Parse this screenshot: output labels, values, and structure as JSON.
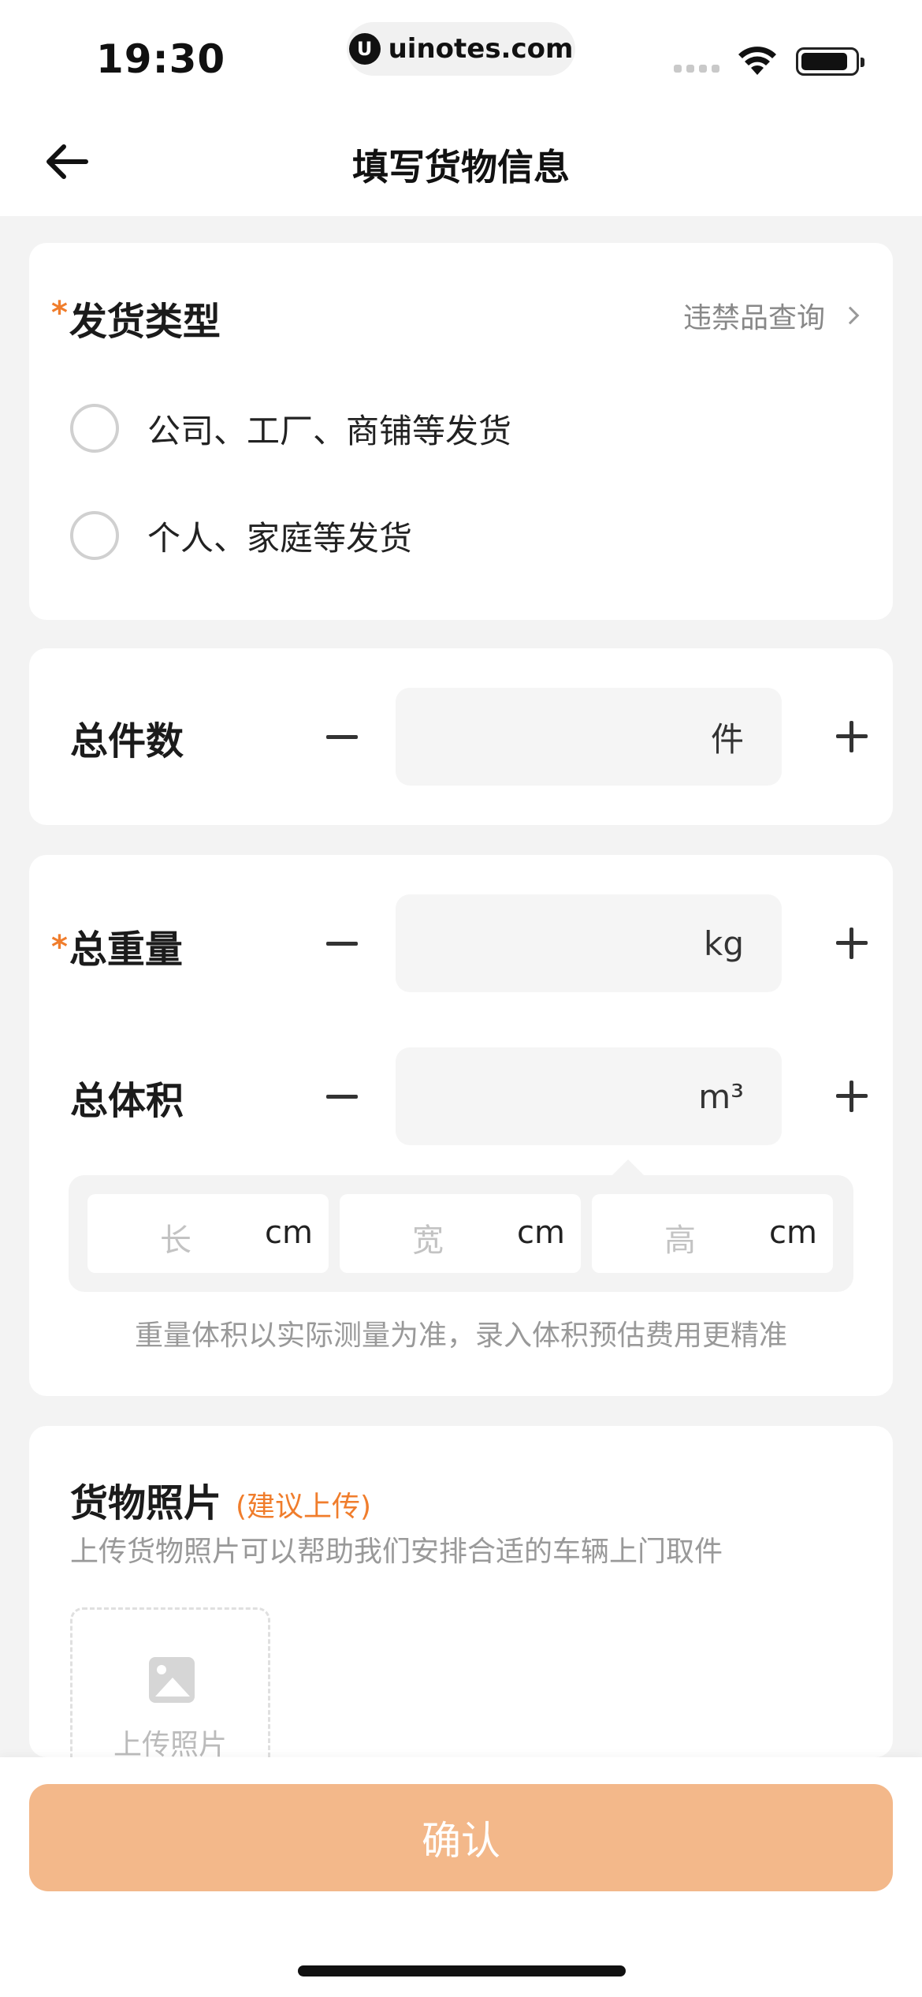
{
  "status_bar": {
    "time": "19:30",
    "url": "uinotes.com",
    "url_logo": "U"
  },
  "nav": {
    "title": "填写货物信息"
  },
  "shipment_type": {
    "required_mark": "*",
    "title": "发货类型",
    "prohibited_link": "违禁品查询",
    "options": [
      {
        "label": "公司、工厂、商铺等发货",
        "selected": false
      },
      {
        "label": "个人、家庭等发货",
        "selected": false
      }
    ]
  },
  "total_count": {
    "label": "总件数",
    "value": "",
    "unit": "件"
  },
  "total_weight": {
    "required_mark": "*",
    "label": "总重量",
    "value": "",
    "unit": "kg"
  },
  "total_volume": {
    "label": "总体积",
    "value": "",
    "unit": "m³"
  },
  "dimensions": [
    {
      "placeholder": "长",
      "unit": "cm"
    },
    {
      "placeholder": "宽",
      "unit": "cm"
    },
    {
      "placeholder": "高",
      "unit": "cm"
    }
  ],
  "note": "重量体积以实际测量为准，录入体积预估费用更精准",
  "photos": {
    "title": "货物照片",
    "suggest": "(建议上传)",
    "subtitle": "上传货物照片可以帮助我们安排合适的车辆上门取件",
    "upload_label": "上传照片"
  },
  "footer": {
    "confirm_label": "确认"
  },
  "colors": {
    "accent": "#f07d2c",
    "confirm_bg": "#f3b88a"
  }
}
